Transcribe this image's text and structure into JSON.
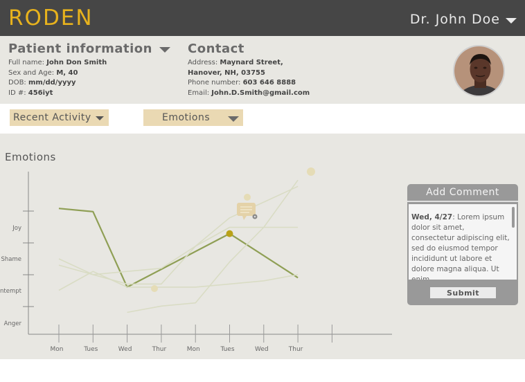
{
  "header": {
    "logo": "RODEN",
    "user": "Dr. John Doe"
  },
  "patient": {
    "title": "Patient information",
    "rows": [
      {
        "label": "Full name: ",
        "value": "John Don Smith"
      },
      {
        "label": "Sex and Age: ",
        "value": "M, 40"
      },
      {
        "label": "DOB: ",
        "value": "mm/dd/yyyy"
      },
      {
        "label": "ID #: ",
        "value": "456iyt"
      }
    ]
  },
  "contact": {
    "title": "Contact",
    "rows": [
      {
        "label": "Address: ",
        "value": "Maynard Street,"
      },
      {
        "label": "",
        "value": "Hanover, NH, 03755"
      },
      {
        "label": "Phone number: ",
        "value": "603 646 8888"
      },
      {
        "label": "Email: ",
        "value": "John.D.Smith@gmail.com"
      }
    ]
  },
  "filters": {
    "activity": "Recent Activity",
    "emotions": "Emotions"
  },
  "comment": {
    "title": "Add Comment",
    "date": "Wed, 4/27",
    "text": ": Lorem ipsum dolor sit amet, consectetur adipiscing elit, sed do eiusmod tempor incididunt ut labore et dolore magna aliqua. Ut enim.....",
    "submit": "Submit"
  },
  "chart_data": {
    "type": "line",
    "title": "Emotions",
    "categories": [
      "Mon",
      "Tues",
      "Wed",
      "Thur",
      "Mon",
      "Tues",
      "Wed",
      "Thur"
    ],
    "y_categories": [
      "Anger",
      "Contempt",
      "Shame",
      "Joy"
    ],
    "grid": false,
    "highlight_color": "#8f9f55",
    "faded_color": "#d9dcc4",
    "series": [
      {
        "highlighted": true,
        "values": [
          3.6,
          3.5,
          1.1,
          null,
          null,
          2.8,
          null,
          1.4
        ]
      },
      {
        "highlighted": false,
        "values": [
          1.8,
          1.5,
          1.2,
          1.2,
          2.4,
          3.3,
          null,
          4.3
        ]
      },
      {
        "highlighted": false,
        "values": [
          2.0,
          1.5,
          1.6,
          1.7,
          2.4,
          3.0,
          3.0,
          3.0
        ]
      },
      {
        "highlighted": false,
        "values": [
          1.0,
          1.6,
          1.1,
          1.1,
          1.1,
          1.2,
          1.3,
          1.5
        ]
      },
      {
        "highlighted": false,
        "values": [
          null,
          null,
          0.3,
          0.5,
          0.6,
          1.9,
          3.0,
          4.5
        ]
      }
    ],
    "marker_icon": "chat-bubble-icon"
  }
}
